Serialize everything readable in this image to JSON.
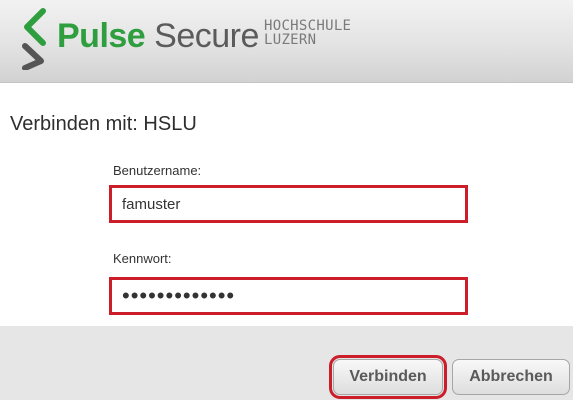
{
  "header": {
    "brand_part1": "Pulse",
    "brand_part2": "Secure",
    "org_line1": "HOCHSCHULE",
    "org_line2": "LUZERN",
    "logo_icon": "pulse-secure-s-icon",
    "colors": {
      "brand_green": "#2f9e3f",
      "brand_gray": "#5b5b5b"
    }
  },
  "dialog": {
    "connect_text": "Verbinden mit: HSLU",
    "username": {
      "label": "Benutzername:",
      "value": "famuster"
    },
    "password": {
      "label": "Kennwort:",
      "value": "•••••••••••••"
    },
    "highlight_color": "#cc1d2a"
  },
  "buttons": {
    "connect_label": "Verbinden",
    "cancel_label": "Abbrechen"
  }
}
